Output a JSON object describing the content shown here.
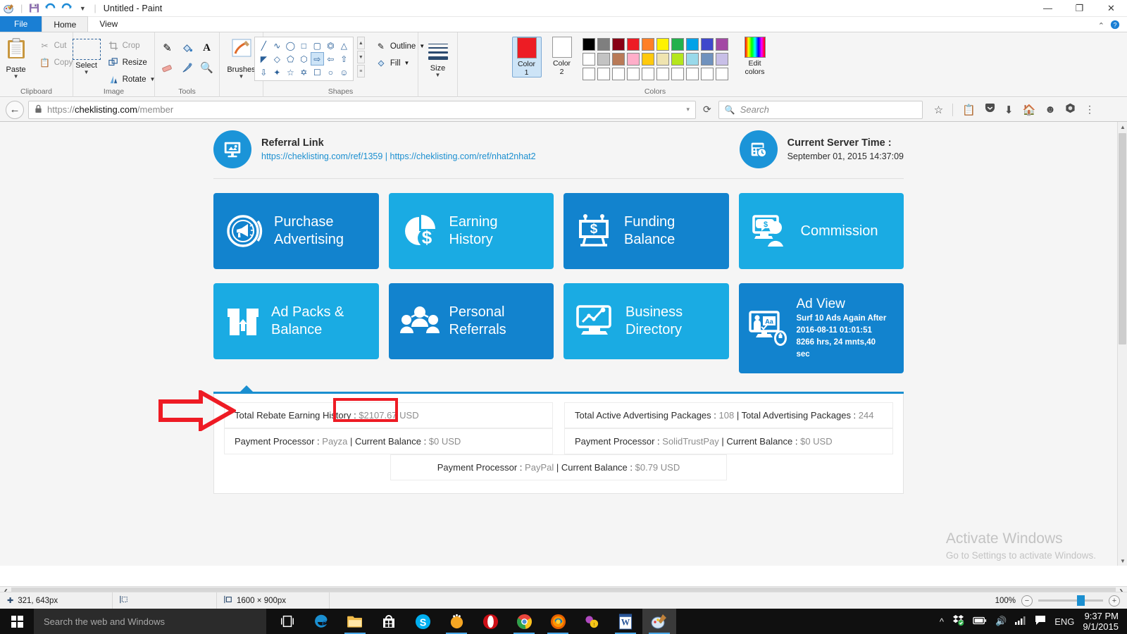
{
  "paint": {
    "title": "Untitled - Paint",
    "quick_access": [
      "paint-palette-icon",
      "save-icon",
      "undo-icon",
      "redo-icon",
      "customize-icon"
    ],
    "window_buttons": {
      "minimize": "—",
      "maximize": "❐",
      "close": "✕"
    },
    "tabs": {
      "file": "File",
      "home": "Home",
      "view": "View"
    },
    "ribbon_help": {
      "collapse": "⌃",
      "help": "?"
    },
    "groups": {
      "clipboard": {
        "label": "Clipboard",
        "paste": "Paste",
        "cut": "Cut",
        "copy": "Copy"
      },
      "image": {
        "label": "Image",
        "select": "Select",
        "crop": "Crop",
        "resize": "Resize",
        "rotate": "Rotate"
      },
      "tools": {
        "label": "Tools"
      },
      "brushes": {
        "label": "Brushes"
      },
      "shapes": {
        "label": "Shapes",
        "outline": "Outline",
        "fill": "Fill"
      },
      "size": {
        "label": "Size"
      },
      "colors": {
        "label": "Colors",
        "color1_label": "Color\n1",
        "color1_line1": "Color",
        "color1_line2": "1",
        "color2_line1": "Color",
        "color2_line2": "2",
        "edit_line1": "Edit",
        "edit_line2": "colors",
        "color1_value": "#ed1c24",
        "color2_value": "#ffffff",
        "row1": [
          "#000000",
          "#7f7f7f",
          "#880015",
          "#ed1c24",
          "#ff7f27",
          "#fff200",
          "#22b14c",
          "#00a2e8",
          "#3f48cc",
          "#a349a4"
        ],
        "row2": [
          "#ffffff",
          "#c3c3c3",
          "#b97a57",
          "#ffaec9",
          "#ffc90e",
          "#efe4b0",
          "#b5e61d",
          "#99d9ea",
          "#7092be",
          "#c8bfe7"
        ],
        "row3": [
          "#ffffff",
          "#ffffff",
          "#ffffff",
          "#ffffff",
          "#ffffff",
          "#ffffff",
          "#ffffff",
          "#ffffff",
          "#ffffff",
          "#ffffff"
        ]
      }
    },
    "status": {
      "cursor_position": "321, 643px",
      "selection_size": "",
      "image_size": "1600 × 900px",
      "zoom_level": "100%",
      "zoom_out": "−",
      "zoom_in": "+"
    }
  },
  "browser": {
    "back_icon": "←",
    "lock_icon": "🔒",
    "url_scheme": "https://",
    "url_host": "cheklisting.com",
    "url_path": "/member",
    "url_dropdown": "▾",
    "reload_icon": "⟳",
    "search_placeholder": "Search",
    "nav_icons": [
      "bookmark-star-icon",
      "reading-list-icon",
      "pocket-icon",
      "downloads-icon",
      "home-icon",
      "smiley-icon",
      "sync-icon",
      "menu-icon"
    ]
  },
  "site": {
    "referral": {
      "title": "Referral Link",
      "link1": "https://cheklisting.com/ref/1359",
      "separator": " | ",
      "link2": "https://cheklisting.com/ref/nhat2nhat2",
      "icon": "screen-presentation-icon"
    },
    "server_time": {
      "title": "Current Server Time :",
      "value": "September 01, 2015 14:37:09",
      "icon": "calendar-clock-icon"
    },
    "tiles": [
      {
        "line1": "Purchase",
        "line2": "Advertising",
        "color": "#1283ce",
        "icon": "megaphone-circle-icon"
      },
      {
        "line1": "Earning",
        "line2": "History",
        "color": "#1aabe3",
        "icon": "pie-chart-dollar-icon"
      },
      {
        "line1": "Funding",
        "line2": "Balance",
        "color": "#1283ce",
        "icon": "billboard-dollar-icon"
      },
      {
        "line1": "Commission",
        "line2": "",
        "color": "#1aabe3",
        "icon": "monitor-person-dollar-icon"
      },
      {
        "line1": "Ad Packs &",
        "line2": "Balance",
        "color": "#1aabe3",
        "icon": "box-arrows-icon"
      },
      {
        "line1": "Personal",
        "line2": "Referrals",
        "color": "#1283ce",
        "icon": "people-group-icon"
      },
      {
        "line1": "Business",
        "line2": "Directory",
        "color": "#1aabe3",
        "icon": "monitor-chart-icon"
      }
    ],
    "ad_view": {
      "title": "Ad View",
      "line1": "Surf 10 Ads Again After",
      "line2": "2016-08-11 01:01:51",
      "line3": "8266 hrs, 24 mnts,40",
      "line4": "sec",
      "color": "#1283ce",
      "icon": "presentation-mouse-icon"
    },
    "stats": {
      "rebate_label": "Total Rebate Earning History : ",
      "rebate_value": "$2107.67 USD",
      "packages_label_1": "Total Active Advertising Packages : ",
      "packages_value_1": "108",
      "packages_sep": " | ",
      "packages_label_2": "Total Advertising Packages : ",
      "packages_value_2": "244",
      "pp1_label": "Payment Processor : ",
      "pp1_name": "Payza",
      "pp1_bal_label": " | Current Balance : ",
      "pp1_bal": "$0 USD",
      "pp2_label": "Payment Processor : ",
      "pp2_name": "SolidTrustPay",
      "pp2_bal_label": " | Current Balance : ",
      "pp2_bal": "$0 USD",
      "pp3_label": "Payment Processor : ",
      "pp3_name": "PayPal",
      "pp3_bal_label": " | Current Balance : ",
      "pp3_bal": "$0.79 USD"
    },
    "annotation": {
      "highlight_color": "#ee1b24",
      "arrow_color": "#ee1b24"
    }
  },
  "watermark": {
    "line1": "Activate Windows",
    "line2": "Go to Settings to activate Windows."
  },
  "taskbar": {
    "search_placeholder": "Search the web and Windows",
    "start_icon": "windows-logo-icon",
    "apps": [
      "task-view-icon",
      "edge-icon",
      "file-explorer-icon",
      "store-icon",
      "skype-icon",
      "sunshine-app-icon",
      "opera-icon",
      "chrome-icon",
      "firefox-icon",
      "messenger-app-icon",
      "word-icon",
      "paint-icon"
    ],
    "tray": [
      "show-hidden-icons",
      "dropbox-icon",
      "battery-icon",
      "volume-icon",
      "network-icon",
      "action-center-icon"
    ],
    "language": "ENG",
    "time": "9:37 PM",
    "date": "9/1/2015"
  }
}
